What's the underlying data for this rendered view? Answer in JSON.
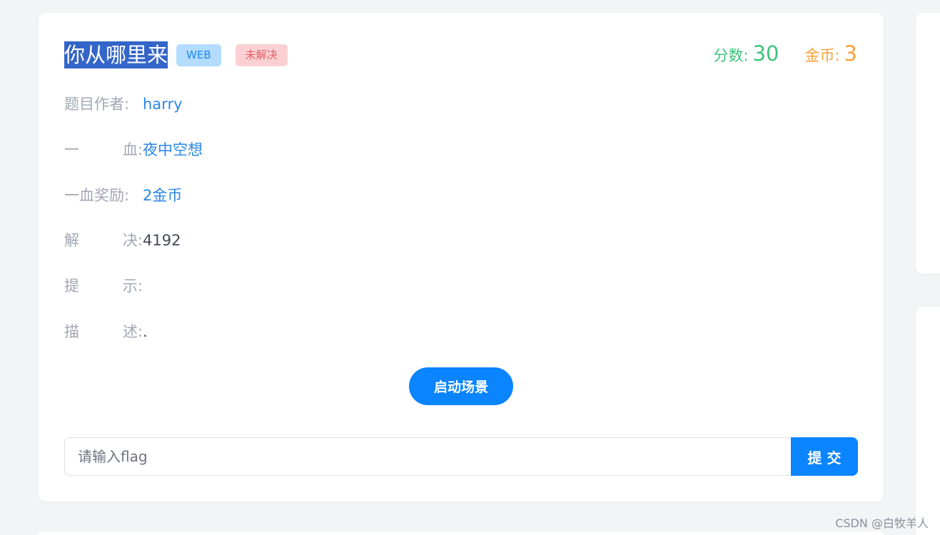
{
  "challenge": {
    "title": "你从哪里来",
    "category_tag": "WEB",
    "status_tag": "未解决",
    "score_label": "分数:",
    "score_value": "30",
    "coin_label": "金币:",
    "coin_value": "3"
  },
  "info": {
    "author": {
      "label_a": "题目作者:",
      "value": "harry"
    },
    "first_blood": {
      "label_a": "一",
      "label_b": "血:",
      "value": "夜中空想"
    },
    "first_blood_reward": {
      "label_a": "一血奖励:",
      "value": "2金币"
    },
    "solves": {
      "label_a": "解",
      "label_b": "决:",
      "value": "4192"
    },
    "hint": {
      "label_a": "提",
      "label_b": "示:",
      "value": ""
    },
    "description": {
      "label_a": "描",
      "label_b": "述:",
      "value": "."
    }
  },
  "actions": {
    "launch_label": "启动场景",
    "flag_placeholder": "请输入flag",
    "submit_label": "提 交"
  },
  "watermark": "CSDN @白牧羊人",
  "colors": {
    "accent": "#0a84ff",
    "score": "#3cc47c",
    "coin": "#f5a23a",
    "link": "#2a86e6",
    "title_highlight": "#3465c8"
  }
}
